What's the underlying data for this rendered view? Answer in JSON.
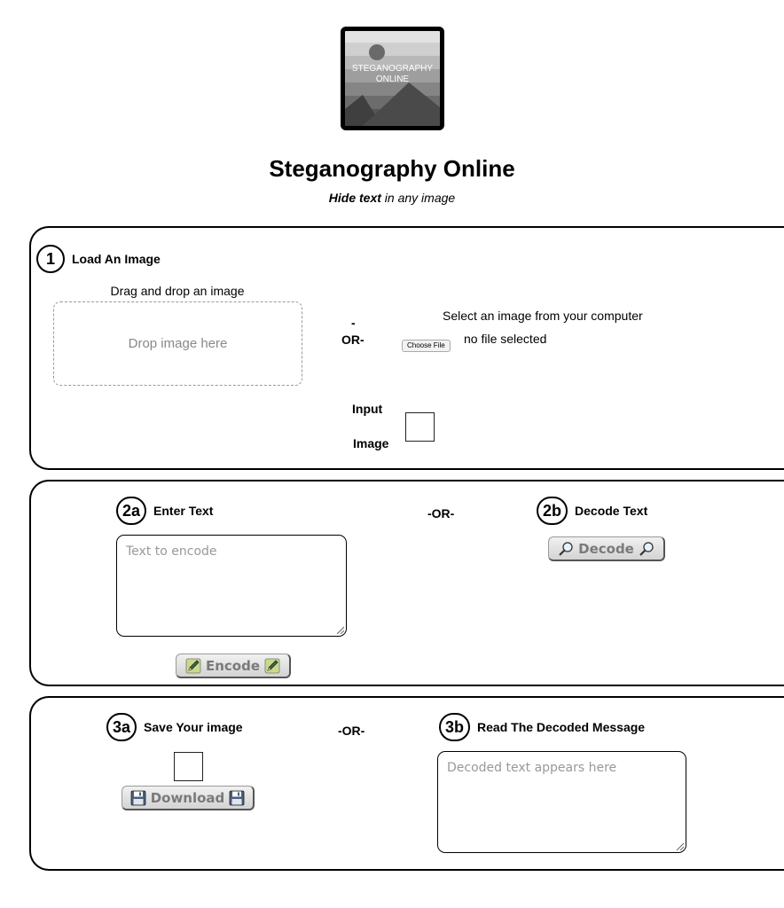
{
  "header": {
    "logo_line1": "STEGANOGRAPHY",
    "logo_line2": "ONLINE",
    "title": "Steganography Online",
    "subtitle_bold": "Hide text",
    "subtitle_rest": " in any image"
  },
  "step1": {
    "badge": "1",
    "title": "Load An Image",
    "drop_label": "Drag and drop an image",
    "dropzone_text": "Drop image here",
    "or_dash": "-",
    "or_text": "OR-",
    "file_label": "Select an image from your computer",
    "file_button": "Choose File",
    "file_status": "no file selected",
    "input_image_line1": "Input",
    "input_image_line2": "Image"
  },
  "step2": {
    "a_badge": "2a",
    "a_title": "Enter Text",
    "or_text": "-OR-",
    "b_badge": "2b",
    "b_title": "Decode Text",
    "encode_placeholder": "Text to encode",
    "encode_button": "Encode",
    "decode_button": "Decode"
  },
  "step3": {
    "a_badge": "3a",
    "a_title": "Save Your image",
    "or_text": "-OR-",
    "b_badge": "3b",
    "b_title": "Read The Decoded Message",
    "download_button": "Download",
    "decoded_placeholder": "Decoded text appears here"
  },
  "icons": {
    "pencil": "pencil-icon",
    "magnifier": "magnifier-icon",
    "floppy": "floppy-disk-icon"
  }
}
